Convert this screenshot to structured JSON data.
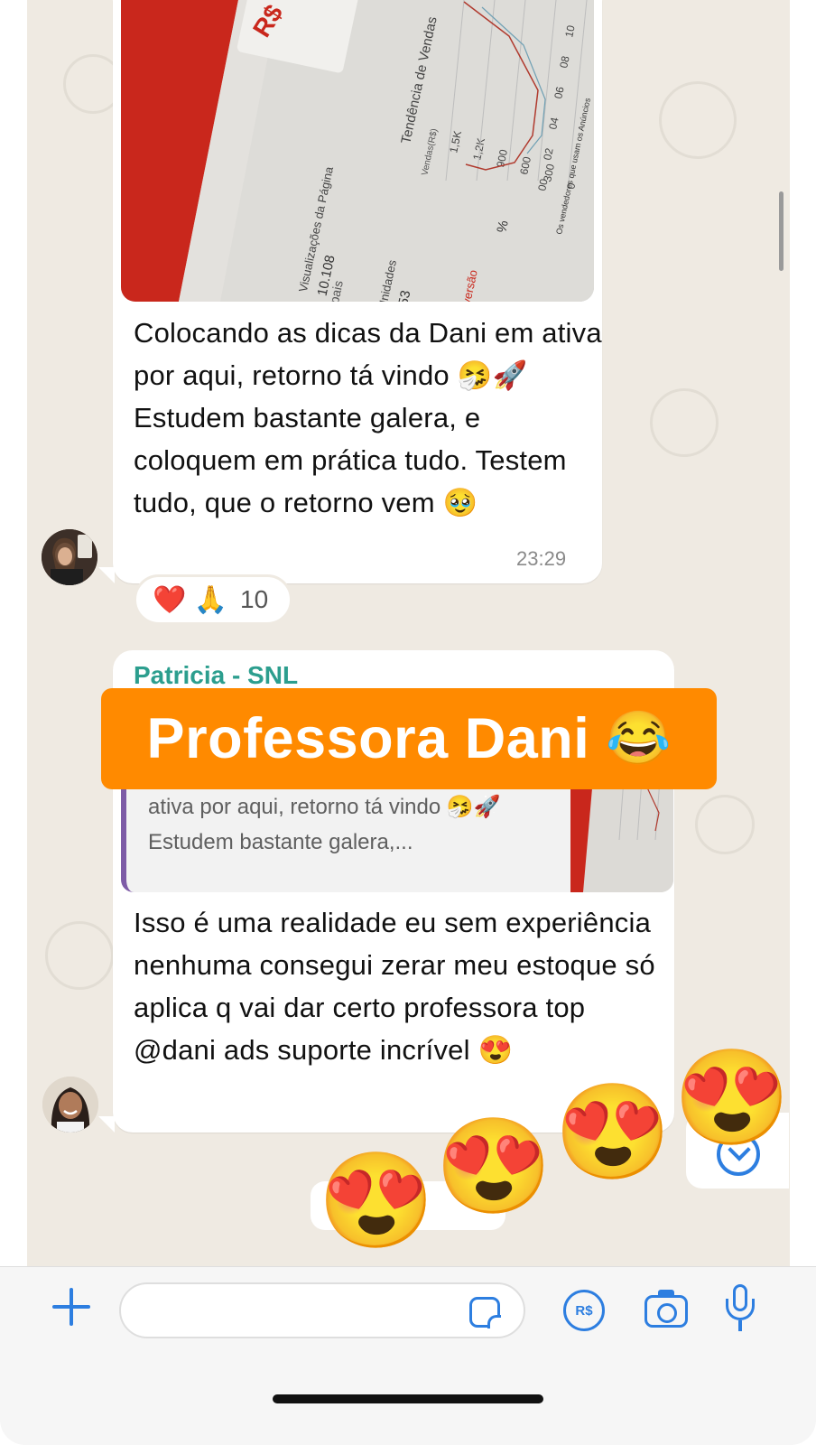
{
  "messages": [
    {
      "text": "Colocando as dicas da Dani em ativa por aqui, retorno tá vindo 🤧🚀 Estudem bastante galera, e coloquem em prática tudo. Testem tudo, que o retorno vem 🥹",
      "time": "23:29",
      "reactions": {
        "emojis": "❤️ 🙏",
        "count": "10"
      },
      "photo": {
        "brand_tag": "R$",
        "chart_title": "Tendência de Vendas",
        "y_axis_label": "Vendas(R$)",
        "y_ticks": [
          "1,5K",
          "1,2K",
          "900",
          "600",
          "300",
          "0"
        ],
        "x_ticks": [
          "00",
          "02",
          "04",
          "06",
          "08",
          "10"
        ],
        "footnote": "Os vendedores que usam os Anúncios",
        "metrics": [
          {
            "label": "Visualizações da Página",
            "value": "10.108"
          },
          {
            "label": "Unidades",
            "value": "153"
          },
          {
            "label": "Conversão",
            "value": "%"
          }
        ],
        "left_label": "ipais"
      }
    },
    {
      "sender": "Patricia - SNL",
      "quote": "ativa por aqui, retorno tá vindo 🤧🚀 Estudem bastante galera,...",
      "text": "Isso é  uma realidade eu sem experiência nenhuma consegui zerar meu estoque só aplica q vai dar certo professora top  @dani ads suporte incrível 😍"
    }
  ],
  "overlay": {
    "text": "Professora Dani",
    "emoji": "😂"
  },
  "floating_emoji": "😍",
  "pill_label": "je",
  "input": {
    "value": "",
    "placeholder": ""
  },
  "icons": {
    "plus": "plus-icon",
    "sticker": "sticker-icon",
    "pay": "R$",
    "camera": "camera-icon",
    "mic": "microphone-icon"
  }
}
